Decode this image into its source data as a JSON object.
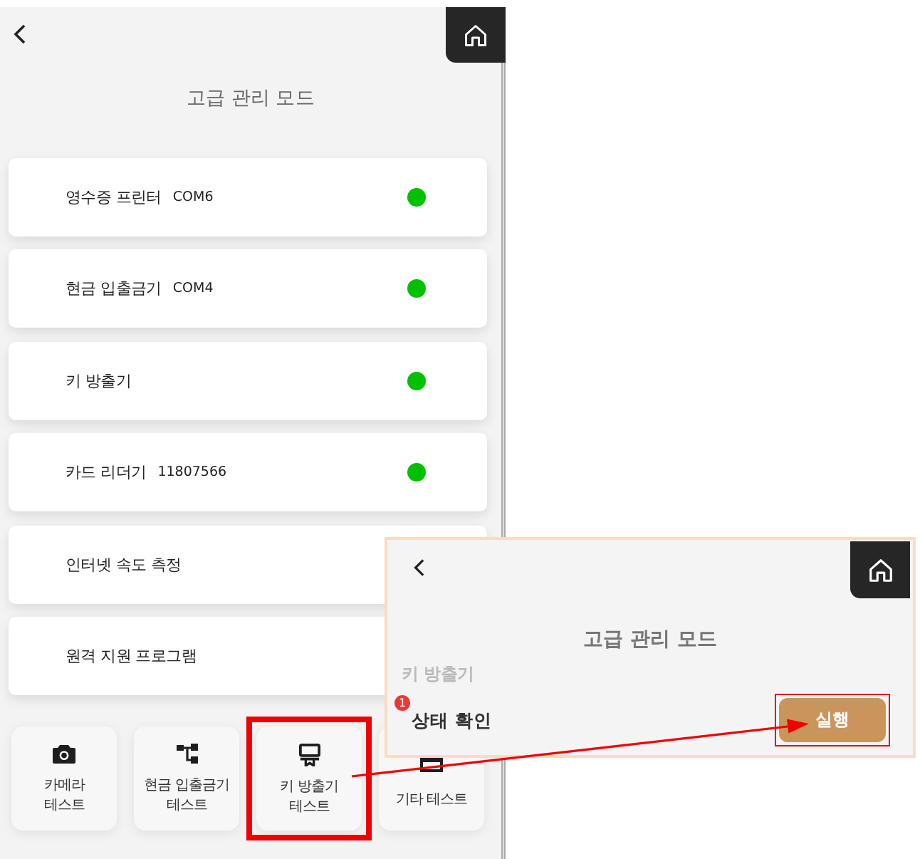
{
  "screen": {
    "title": "고급 관리 모드",
    "devices": [
      {
        "name": "영수증 프린터",
        "detail": "COM6",
        "color": "#00c000"
      },
      {
        "name": "현금 입출금기",
        "detail": "COM4",
        "color": "#00c000"
      },
      {
        "name": "키 방출기",
        "color": "#00c000"
      },
      {
        "name": "카드 리더기",
        "detail": "11807566",
        "color": "#00c000"
      },
      {
        "name": "인터넷 속도 측정"
      },
      {
        "name": "원격 지원 프로그램"
      }
    ],
    "tests": [
      {
        "kind": "camera",
        "label": "카메라\n테스트",
        "highlighted": false
      },
      {
        "kind": "blocks",
        "label": "현금 입출금기\n테스트",
        "highlighted": false
      },
      {
        "kind": "dispenser",
        "label": "키 방출기\n테스트",
        "highlighted": true
      },
      {
        "kind": "tray",
        "label": "기타 테스트",
        "highlighted": false
      }
    ]
  },
  "inset": {
    "title": "고급 관리 모드",
    "section": "키 방출기",
    "task": {
      "label": "상태 확인",
      "badge": "1",
      "action": "실행",
      "highlighted": true
    }
  },
  "callout_arrow": true
}
